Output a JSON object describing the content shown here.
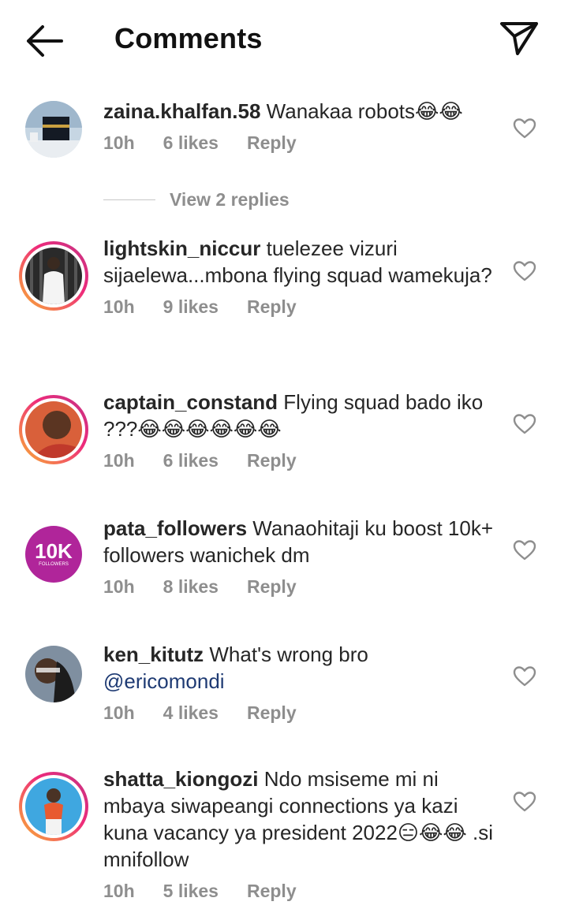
{
  "header": {
    "title": "Comments",
    "back_icon": "arrow-left-icon",
    "send_icon": "paper-plane-icon"
  },
  "comments": [
    {
      "username": "zaina.khalfan.58",
      "text": "Wanakaa robots😂😂",
      "time": "10h",
      "likes": "6 likes",
      "reply": "Reply",
      "view_replies": "View 2 replies"
    },
    {
      "username": "lightskin_niccur",
      "text": "tuelezee vizuri sijaelewa...mbona flying squad wamekuja?",
      "time": "10h",
      "likes": "9 likes",
      "reply": "Reply"
    },
    {
      "username": "captain_constand",
      "text": "Flying squad bado iko ???😂😂😂😂😂😂",
      "time": "10h",
      "likes": "6 likes",
      "reply": "Reply"
    },
    {
      "username": "pata_followers",
      "text": "Wanaohitaji ku boost 10k+ followers wanichek dm",
      "time": "10h",
      "likes": "8 likes",
      "reply": "Reply",
      "avatar_text": "10K",
      "avatar_subtext": "FOLLOWERS"
    },
    {
      "username": "ken_kitutz",
      "text": "What's wrong bro",
      "mention": "@ericomondi",
      "time": "10h",
      "likes": "4 likes",
      "reply": "Reply"
    },
    {
      "username": "shatta_kiongozi",
      "text": "Ndo msiseme mi ni mbaya siwapeangi connections ya kazi kuna vacancy ya president 2022😑😂😂 .si mnifollow",
      "time": "10h",
      "likes": "5 likes",
      "reply": "Reply"
    }
  ],
  "colors": {
    "text": "#262626",
    "meta": "#8e8e8e",
    "mention": "#1e3a73",
    "story_ring_start": "#f9b233",
    "story_ring_end": "#c13584",
    "badge_purple": "#b0259a"
  }
}
